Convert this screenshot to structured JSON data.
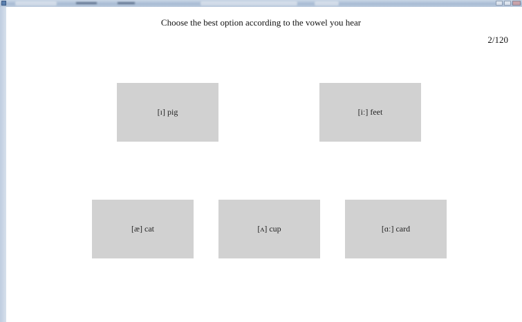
{
  "window": {
    "controls": [
      "minimize",
      "maximize",
      "close"
    ]
  },
  "quiz": {
    "instruction": "Choose the best option according to the vowel you hear",
    "counter": "2/120",
    "options": [
      {
        "label": "[ɪ] pig"
      },
      {
        "label": "[iː] feet"
      },
      {
        "label": "[æ] cat"
      },
      {
        "label": "[ʌ] cup"
      },
      {
        "label": "[ɑː] card"
      }
    ]
  },
  "colors": {
    "option_background": "#d1d1d1",
    "page_background": "#ffffff",
    "text": "#111111"
  }
}
